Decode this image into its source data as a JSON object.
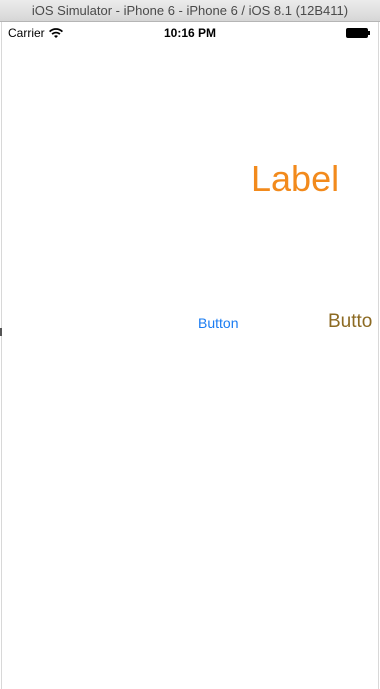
{
  "window": {
    "title": "iOS Simulator - iPhone 6 - iPhone 6 / iOS 8.1 (12B411)"
  },
  "statusbar": {
    "carrier": "Carrier",
    "time": "10:16 PM",
    "wifi_icon": "wifi-icon",
    "battery_icon": "battery-icon"
  },
  "content": {
    "label_text": "Label",
    "label_color": "#f28a1c",
    "button_blue_label": "Button",
    "button_blue_color": "#1a7cf2",
    "button_gold_label": "Butto",
    "button_gold_color": "#8c6a22"
  }
}
